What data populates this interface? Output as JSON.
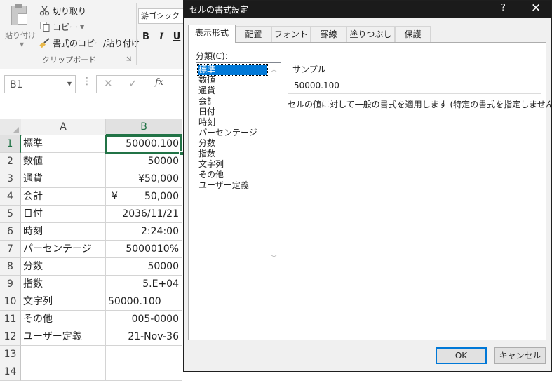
{
  "ribbon": {
    "paste_label": "貼り付け",
    "cut_label": "切り取り",
    "copy_label": "コピー",
    "format_painter_label": "書式のコピー/貼り付け",
    "clipboard_group_label": "クリップボード",
    "font_name": "游ゴシック",
    "bold_label": "B",
    "italic_label": "I",
    "underline_label": "U"
  },
  "formula_bar": {
    "name_box": "B1",
    "fx_label": "fx"
  },
  "sheet": {
    "columns": [
      "A",
      "B"
    ],
    "rows": [
      {
        "num": "1",
        "a": "標準",
        "b": "50000.100"
      },
      {
        "num": "2",
        "a": "数値",
        "b": "50000"
      },
      {
        "num": "3",
        "a": "通貨",
        "b": "¥50,000"
      },
      {
        "num": "4",
        "a": "会計",
        "b_symbol": "¥",
        "b": "50,000"
      },
      {
        "num": "5",
        "a": "日付",
        "b": "2036/11/21"
      },
      {
        "num": "6",
        "a": "時刻",
        "b": "2:24:00"
      },
      {
        "num": "7",
        "a": "パーセンテージ",
        "b": "5000010%"
      },
      {
        "num": "8",
        "a": "分数",
        "b": "50000"
      },
      {
        "num": "9",
        "a": "指数",
        "b": "5.E+04"
      },
      {
        "num": "10",
        "a": "文字列",
        "b": "50000.100"
      },
      {
        "num": "11",
        "a": "その他",
        "b": "005-0000"
      },
      {
        "num": "12",
        "a": "ユーザー定義",
        "b": "21-Nov-36"
      },
      {
        "num": "13",
        "a": "",
        "b": ""
      },
      {
        "num": "14",
        "a": "",
        "b": ""
      }
    ]
  },
  "dialog": {
    "title": "セルの書式設定",
    "help": "?",
    "close": "✕",
    "tabs": [
      "表示形式",
      "配置",
      "フォント",
      "罫線",
      "塗りつぶし",
      "保護"
    ],
    "category_label": "分類(C):",
    "categories": [
      "標準",
      "数値",
      "通貨",
      "会計",
      "日付",
      "時刻",
      "パーセンテージ",
      "分数",
      "指数",
      "文字列",
      "その他",
      "ユーザー定義"
    ],
    "selected_category": "標準",
    "sample_label": "サンプル",
    "sample_value": "50000.100",
    "description": "セルの値に対して一般の書式を適用します (特定の書式を指定しません)。",
    "ok_label": "OK",
    "cancel_label": "キャンセル"
  }
}
